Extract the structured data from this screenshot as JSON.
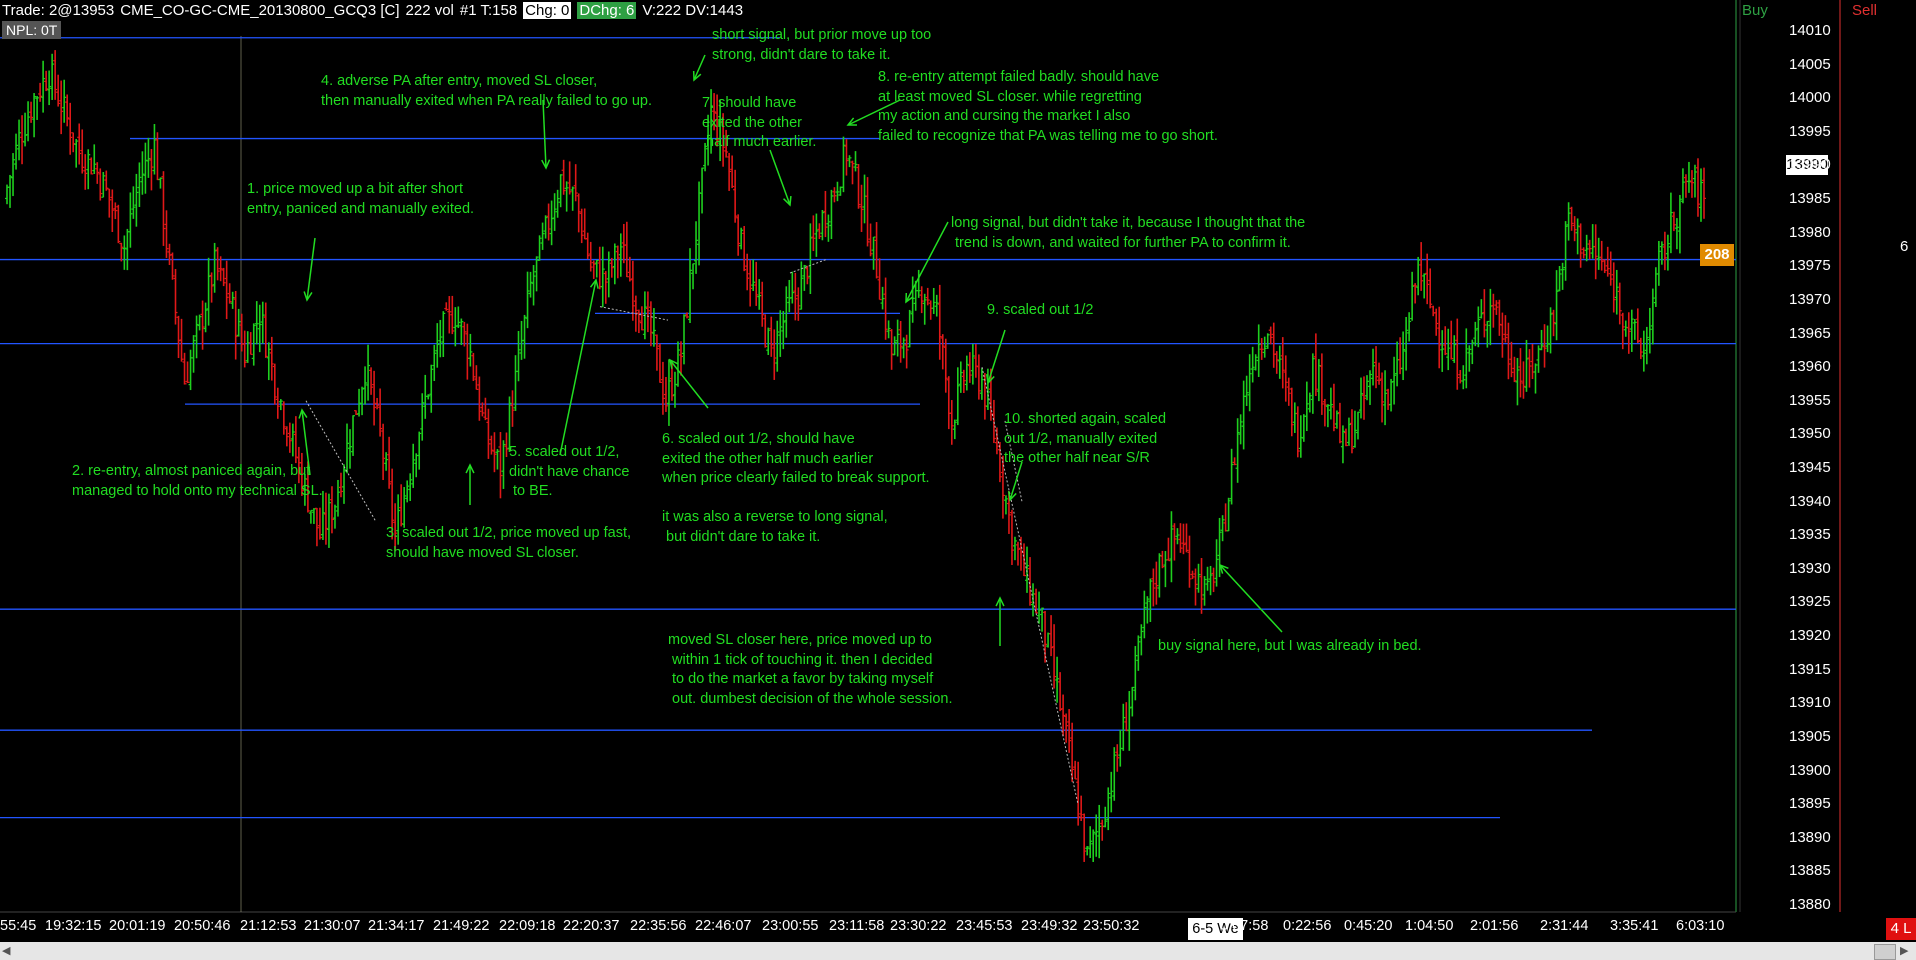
{
  "header": {
    "trade": "Trade: 2@13953",
    "symbol": "CME_CO-GC-CME_20130800_GCQ3 [C]",
    "vol": "222 vol",
    "bar_info": "#1 T:158",
    "chg": "Chg: 0",
    "dchg": "DChg: 6",
    "v": "V:222 DV:1443",
    "npl": "NPL: 0T"
  },
  "right_panel": {
    "buy_label": "Buy",
    "sell_label": "Sell",
    "side_count": "6",
    "last_price_tag": "13990",
    "volume_tag": "208",
    "lots_tag": "4 L",
    "date_tag": "6-5 We"
  },
  "colors": {
    "background": "#000000",
    "up_bar": "#1ecf1e",
    "down_bar": "#e01818",
    "level_line": "#2255ff",
    "annotation": "#22dd22"
  },
  "chart_data": {
    "type": "bar",
    "y_axis": {
      "ticks": [
        14010,
        14005,
        14000,
        13995,
        13990,
        13985,
        13980,
        13975,
        13970,
        13965,
        13960,
        13955,
        13950,
        13945,
        13940,
        13935,
        13930,
        13925,
        13920,
        13915,
        13910,
        13905,
        13900,
        13895,
        13890,
        13885,
        13880
      ],
      "range": [
        13878,
        14013
      ]
    },
    "x_axis": {
      "ticks": [
        "55:45",
        "19:32:15",
        "20:01:19",
        "20:50:46",
        "21:12:53",
        "21:30:07",
        "21:34:17",
        "21:49:22",
        "22:09:18",
        "22:20:37",
        "22:35:56",
        "22:46:07",
        "23:00:55",
        "23:11:58",
        "23:30:22",
        "23:45:53",
        "23:49:32",
        "23:50:32",
        "0:07:58",
        "0:22:56",
        "0:45:20",
        "1:04:50",
        "2:01:56",
        "2:31:44",
        "3:35:41",
        "6:03:10"
      ]
    },
    "levels": [
      14009,
      13994,
      13976,
      13963.5,
      13954.5,
      13968,
      13924,
      13906,
      13893
    ],
    "price_path": [
      [
        0,
        13985
      ],
      [
        15,
        13994
      ],
      [
        30,
        14000
      ],
      [
        45,
        14004
      ],
      [
        60,
        13998
      ],
      [
        75,
        13992
      ],
      [
        90,
        13990
      ],
      [
        105,
        13985
      ],
      [
        120,
        13978
      ],
      [
        135,
        13988
      ],
      [
        150,
        13993
      ],
      [
        165,
        13975
      ],
      [
        180,
        13958
      ],
      [
        195,
        13966
      ],
      [
        210,
        13975
      ],
      [
        225,
        13970
      ],
      [
        240,
        13962
      ],
      [
        255,
        13968
      ],
      [
        270,
        13958
      ],
      [
        285,
        13950
      ],
      [
        300,
        13942
      ],
      [
        315,
        13935
      ],
      [
        330,
        13940
      ],
      [
        345,
        13950
      ],
      [
        360,
        13960
      ],
      [
        375,
        13950
      ],
      [
        390,
        13935
      ],
      [
        405,
        13945
      ],
      [
        420,
        13955
      ],
      [
        435,
        13965
      ],
      [
        450,
        13968
      ],
      [
        465,
        13962
      ],
      [
        480,
        13950
      ],
      [
        495,
        13945
      ],
      [
        510,
        13958
      ],
      [
        525,
        13972
      ],
      [
        540,
        13980
      ],
      [
        555,
        13988
      ],
      [
        570,
        13985
      ],
      [
        585,
        13975
      ],
      [
        600,
        13973
      ],
      [
        615,
        13978
      ],
      [
        630,
        13970
      ],
      [
        645,
        13965
      ],
      [
        660,
        13955
      ],
      [
        675,
        13962
      ],
      [
        690,
        13980
      ],
      [
        705,
        13998
      ],
      [
        720,
        13992
      ],
      [
        735,
        13978
      ],
      [
        750,
        13970
      ],
      [
        765,
        13962
      ],
      [
        780,
        13968
      ],
      [
        795,
        13972
      ],
      [
        810,
        13980
      ],
      [
        825,
        13985
      ],
      [
        840,
        13992
      ],
      [
        855,
        13985
      ],
      [
        870,
        13975
      ],
      [
        885,
        13962
      ],
      [
        900,
        13965
      ],
      [
        915,
        13972
      ],
      [
        930,
        13968
      ],
      [
        945,
        13952
      ],
      [
        960,
        13960
      ],
      [
        975,
        13958
      ],
      [
        990,
        13948
      ],
      [
        1005,
        13935
      ],
      [
        1020,
        13928
      ],
      [
        1035,
        13922
      ],
      [
        1050,
        13912
      ],
      [
        1065,
        13900
      ],
      [
        1080,
        13887
      ],
      [
        1095,
        13893
      ],
      [
        1110,
        13902
      ],
      [
        1125,
        13912
      ],
      [
        1140,
        13925
      ],
      [
        1155,
        13932
      ],
      [
        1170,
        13935
      ],
      [
        1185,
        13930
      ],
      [
        1200,
        13926
      ],
      [
        1215,
        13935
      ],
      [
        1230,
        13950
      ],
      [
        1245,
        13962
      ],
      [
        1260,
        13966
      ],
      [
        1275,
        13958
      ],
      [
        1290,
        13950
      ],
      [
        1305,
        13960
      ],
      [
        1320,
        13955
      ],
      [
        1335,
        13948
      ],
      [
        1350,
        13952
      ],
      [
        1365,
        13960
      ],
      [
        1380,
        13955
      ],
      [
        1395,
        13962
      ],
      [
        1410,
        13975
      ],
      [
        1425,
        13968
      ],
      [
        1440,
        13962
      ],
      [
        1455,
        13960
      ],
      [
        1470,
        13966
      ],
      [
        1485,
        13970
      ],
      [
        1500,
        13962
      ],
      [
        1515,
        13958
      ],
      [
        1530,
        13962
      ],
      [
        1545,
        13968
      ],
      [
        1560,
        13982
      ],
      [
        1575,
        13978
      ],
      [
        1590,
        13976
      ],
      [
        1605,
        13972
      ],
      [
        1620,
        13966
      ],
      [
        1635,
        13962
      ],
      [
        1650,
        13975
      ],
      [
        1665,
        13982
      ],
      [
        1680,
        13988
      ],
      [
        1695,
        13985
      ]
    ]
  },
  "annotations": [
    {
      "text": "1. price moved up a bit after short\nentry, paniced and manually exited."
    },
    {
      "text": "2. re-entry, almost paniced again, but\nmanaged to hold onto my technical SL."
    },
    {
      "text": "3. scaled out 1/2, price moved up fast,\nshould have moved SL closer."
    },
    {
      "text": "4. adverse PA after entry, moved SL closer,\nthen manually exited when PA really failed to go up."
    },
    {
      "text": "5. scaled out 1/2,\ndidn't have chance\n to BE."
    },
    {
      "text": "short signal, but prior move up too\nstrong, didn't dare to take it."
    },
    {
      "text": "7. should have\nexited the other\n half much earlier."
    },
    {
      "text": "6. scaled out 1/2, should have\nexited the other half much earlier\nwhen price clearly failed to break support.\n\nit was also a reverse to long signal,\n but didn't dare to take it."
    },
    {
      "text": "8. re-entry attempt failed badly. should have\nat least moved SL closer. while regretting\nmy action and cursing the market I also\nfailed to recognize that PA was telling me to go short."
    },
    {
      "text": "long signal, but didn't take it, because I thought that the\n trend is down, and waited for further PA to confirm it."
    },
    {
      "text": "9. scaled out 1/2"
    },
    {
      "text": "10. shorted again, scaled\nout 1/2, manually exited\nthe other half near S/R"
    },
    {
      "text": "moved SL closer here, price moved up to\n within 1 tick of touching it. then I decided\n to do the market a favor by taking myself\n out. dumbest decision of the whole session."
    },
    {
      "text": "buy signal here, but I was already in bed."
    }
  ]
}
